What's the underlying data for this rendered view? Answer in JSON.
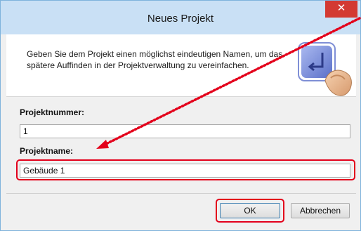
{
  "dialog": {
    "title": "Neues Projekt",
    "close_glyph": "✕",
    "description": "Geben Sie dem Projekt einen möglichst eindeutigen Namen, um das spätere Auffinden in der Projektverwaltung zu vereinfachen.",
    "icon": "enter-key-icon"
  },
  "form": {
    "project_number_label": "Projektnummer:",
    "project_number_value": "1",
    "project_name_label": "Projektname:",
    "project_name_value": "Gebäude 1"
  },
  "buttons": {
    "ok_label": "OK",
    "cancel_label": "Abbrechen"
  },
  "annotation": {
    "highlight_color": "#e3001b",
    "arrow": "dotted-red-arrow"
  }
}
